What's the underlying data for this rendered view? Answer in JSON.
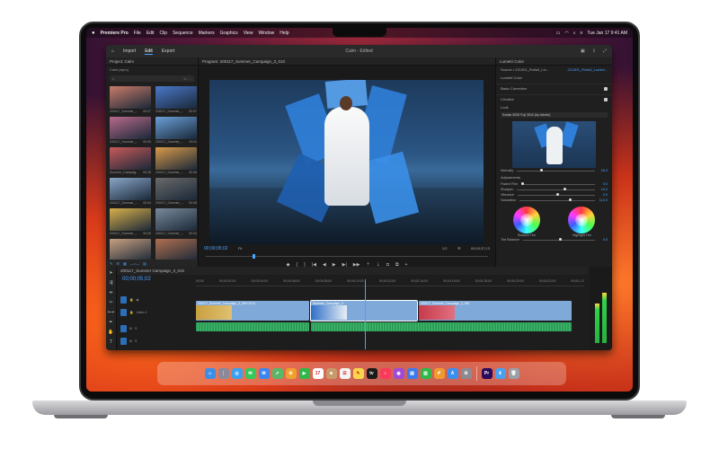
{
  "menubar": {
    "apple": "",
    "app": "Premiere Pro",
    "items": [
      "File",
      "Edit",
      "Clip",
      "Sequence",
      "Markers",
      "Graphics",
      "View",
      "Window",
      "Help"
    ],
    "clock": "Tue Jan 17  9:41 AM"
  },
  "window": {
    "tabs": [
      "Import",
      "Edit",
      "Export"
    ],
    "active_tab": "Edit",
    "title": "Calm - Edited"
  },
  "project": {
    "header": "Project: Calm",
    "path": "Calm.prproj",
    "search_hint": "1 / ...",
    "items": [
      {
        "name": "200117_Summer_...",
        "dur": "00:07",
        "color": "#c97b6a"
      },
      {
        "name": "200117_Summer_...",
        "dur": "00:07",
        "color": "#4a78c8"
      },
      {
        "name": "200117_Summer_...",
        "dur": "00:09",
        "color": "#b86a8a"
      },
      {
        "name": "200117_Summer_...",
        "dur": "00:11",
        "color": "#6aa0d8"
      },
      {
        "name": "Summer_Campaig...",
        "dur": "00:28",
        "color": "#c85a5a"
      },
      {
        "name": "200117_Summer_...",
        "dur": "00:06",
        "color": "#d89a4a"
      },
      {
        "name": "200117_Summer_...",
        "dur": "00:04",
        "color": "#8aa6c8"
      },
      {
        "name": "200117_Summer_...",
        "dur": "00:08",
        "color": "#6a6a6a"
      },
      {
        "name": "200117_Summer_...",
        "dur": "00:05",
        "color": "#d8b04a"
      },
      {
        "name": "200117_Summer_...",
        "dur": "00:04",
        "color": "#7a8a9a"
      },
      {
        "name": "200117_Summer_...",
        "dur": "00:05",
        "color": "#c8a080"
      },
      {
        "name": "200117_Summer_...",
        "dur": "00:04",
        "color": "#b07050"
      }
    ]
  },
  "program": {
    "header": "Program: 200117_Summer_Campaign_3_010",
    "timecode": "00;00;05;02",
    "fit": "Fit",
    "quality": "1/2",
    "duration": "00;00;37;13"
  },
  "lumetri": {
    "header": "Lumetri Color",
    "source": "Source • 221301_Rolla3_Lin...",
    "target": "221301_Rolla3_Lumiet...",
    "effect": "Lumetri Color",
    "basic": "Basic Correction",
    "creative": "Creative",
    "look_label": "Look",
    "look_value": "Kodak 5205 Fuji 3510 (by Adobe)",
    "intensity_label": "Intensity",
    "intensity_value": "26.0",
    "adjustments": "Adjustments",
    "sliders": [
      {
        "label": "Faded Film",
        "value": "0.0",
        "pos": 0
      },
      {
        "label": "Sharpen",
        "value": "10.0",
        "pos": 0.6
      },
      {
        "label": "Vibrance",
        "value": "0.0",
        "pos": 0.5
      },
      {
        "label": "Saturation",
        "value": "113.0",
        "pos": 0.65
      }
    ],
    "shadow_tint": "Shadow Tint",
    "highlight_tint": "Highlight Tint",
    "tint_balance": "Tint Balance",
    "tint_balance_value": "0.0"
  },
  "timeline": {
    "header": "200117_Summer Campaign_3_010",
    "timecode": "00;00;05;02",
    "ruler": [
      "00;00",
      "00;00;02;00",
      "00;00;04;00",
      "00;00;06;00",
      "00;00;08;00",
      "00;00;10;00",
      "00;00;12;00",
      "00;00;14;00",
      "00;00;16;00",
      "00;00;18;00",
      "00;00;20;00",
      "00;00;22;00",
      "00;00;1.0"
    ],
    "video_label": "Video 1",
    "clips": [
      "200117_Summer_Campaign_3_009.CK10",
      "Summer_Campaign_3",
      "200117_Summer_Campaign_3_061"
    ],
    "meter_levels": [
      0.55,
      0.7
    ]
  },
  "dock": {
    "apps": [
      {
        "name": "finder",
        "color": "#3a8ee6",
        "glyph": "☺"
      },
      {
        "name": "launchpad",
        "color": "#8a8a9a",
        "glyph": "⋮"
      },
      {
        "name": "safari",
        "color": "#3aa0f0",
        "glyph": "◎"
      },
      {
        "name": "messages",
        "color": "#34c759",
        "glyph": "✉"
      },
      {
        "name": "mail",
        "color": "#3a86f0",
        "glyph": "✉"
      },
      {
        "name": "maps",
        "color": "#58b86a",
        "glyph": "➚"
      },
      {
        "name": "photos",
        "color": "#f0a030",
        "glyph": "✿"
      },
      {
        "name": "facetime",
        "color": "#2fb84a",
        "glyph": "▶"
      },
      {
        "name": "calendar",
        "color": "#ffffff",
        "glyph": "17"
      },
      {
        "name": "contacts",
        "color": "#c89a6a",
        "glyph": "☻"
      },
      {
        "name": "reminders",
        "color": "#f4f4f4",
        "glyph": "☰"
      },
      {
        "name": "notes",
        "color": "#f8d84a",
        "glyph": "✎"
      },
      {
        "name": "tv",
        "color": "#1a1a1a",
        "glyph": "tv"
      },
      {
        "name": "music",
        "color": "#fa3a5a",
        "glyph": "♪"
      },
      {
        "name": "podcasts",
        "color": "#a04ad8",
        "glyph": "◉"
      },
      {
        "name": "keynote",
        "color": "#3a7af0",
        "glyph": "▤"
      },
      {
        "name": "numbers",
        "color": "#2fb84a",
        "glyph": "▥"
      },
      {
        "name": "pages",
        "color": "#f09a30",
        "glyph": "✐"
      },
      {
        "name": "app-store",
        "color": "#3a8ef0",
        "glyph": "A"
      },
      {
        "name": "system-settings",
        "color": "#8a8a92",
        "glyph": "⚙"
      },
      {
        "name": "premiere-pro",
        "color": "#2a0a5a",
        "glyph": "Pr"
      },
      {
        "name": "downloads",
        "color": "#4aa0f0",
        "glyph": "⬇"
      },
      {
        "name": "trash",
        "color": "#9aa0a8",
        "glyph": "🗑"
      }
    ]
  }
}
